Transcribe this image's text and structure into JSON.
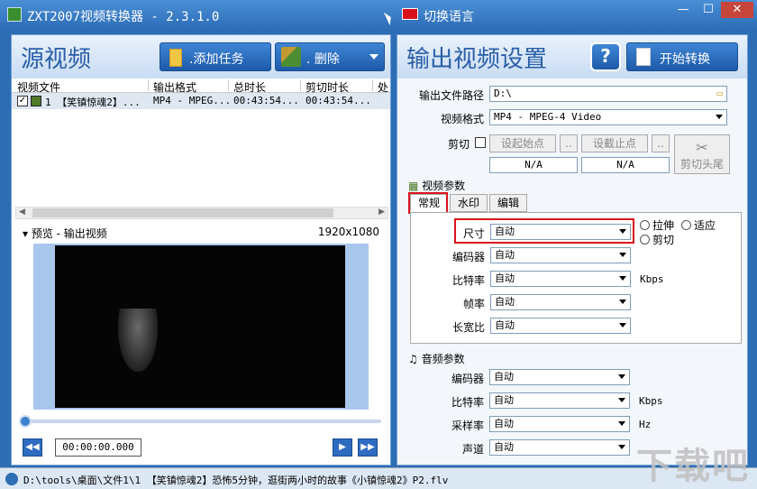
{
  "window": {
    "title": "ZXT2007视频转换器 - 2.3.1.0",
    "language_label": "切换语言",
    "min": "—",
    "max": "☐",
    "close": "✕"
  },
  "left": {
    "title": "源视频",
    "add_task": ".添加任务",
    "delete": ".   删除",
    "columns": [
      "视频文件",
      "输出格式",
      "总时长",
      "剪切时长",
      "处"
    ],
    "row": {
      "checked": "✓",
      "file": "1 【笑镇惊魂2】...",
      "format": "MP4 - MPEG...",
      "duration": "00:43:54...",
      "cut_duration": "00:43:54..."
    },
    "preview_label": "▾ 预览 - 输出视频",
    "resolution": "1920x1080",
    "time": "00:00:00.000",
    "controls": [
      "◀◀",
      "▶",
      "▶▶"
    ]
  },
  "right": {
    "title": "输出视频设置",
    "help": "?",
    "start": "开始转换",
    "output_path_label": "输出文件路径",
    "output_path": "D:\\",
    "format_label": "视频格式",
    "format_value": "MP4 - MPEG-4 Video",
    "cut_label": "剪切",
    "set_start": "设起始点",
    "set_end": "设截止点",
    "ellipsis": "..",
    "start_value": "N/A",
    "end_value": "N/A",
    "cut_head_tail": "剪切头尾",
    "video_params_title": "视频参数",
    "tabs": [
      "常规",
      "水印",
      "编辑"
    ],
    "video_fields": [
      {
        "label": "尺寸",
        "value": "自动"
      },
      {
        "label": "编码器",
        "value": "自动"
      },
      {
        "label": "比特率",
        "value": "自动"
      },
      {
        "label": "帧率",
        "value": "自动"
      },
      {
        "label": "长宽比",
        "value": "自动"
      }
    ],
    "size_options": [
      "拉伸",
      "适应",
      "剪切"
    ],
    "bitrate_unit": "Kbps",
    "audio_params_title": "音频参数",
    "audio_fields": [
      {
        "label": "编码器",
        "value": "自动"
      },
      {
        "label": "比特率",
        "value": "自动"
      },
      {
        "label": "采样率",
        "value": "自动"
      },
      {
        "label": "声道",
        "value": "自动"
      }
    ],
    "audio_units": [
      "Kbps",
      "Hz"
    ]
  },
  "status": {
    "path": "D:\\tools\\桌面\\文件1\\1 【笑镇惊魂2】恐怖5分钟，逛街两小时的故事《小镇惊魂2》P2.flv"
  },
  "watermark": "下载吧"
}
